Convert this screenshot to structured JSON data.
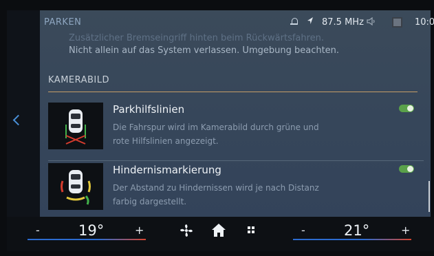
{
  "status_bar": {
    "title": "PARKEN",
    "radio_frequency": "87.5 MHz",
    "time": "10:0"
  },
  "intro": {
    "line1": "Zusätzlicher Bremseingriff hinten beim Rückwärtsfahren.",
    "line2": "Nicht allein auf das System verlassen. Umgebung beachten."
  },
  "section": {
    "label": "KAMERABILD"
  },
  "settings": [
    {
      "title": "Parkhilfslinien",
      "desc_line1": "Die Fahrspur wird im Kamerabild durch grüne und",
      "desc_line2": "rote Hilfslinien angezeigt.",
      "enabled": true
    },
    {
      "title": "Hindernismarkierung",
      "desc_line1": "Der Abstand zu Hindernissen wird je nach Distanz",
      "desc_line2": "farbig dargestellt.",
      "enabled": true
    }
  ],
  "climate": {
    "left_minus": "-",
    "left_temp": "19°",
    "left_plus": "+",
    "right_minus": "-",
    "right_temp": "21°",
    "right_plus": "+"
  },
  "colors": {
    "accent_blue": "#4a90d9",
    "toggle_on": "#5aa14a",
    "section_divider": "#c59d67"
  },
  "icons": {
    "status": [
      "bell-icon",
      "navigation-arrow-icon",
      "speaker-icon",
      "phone-box-icon"
    ],
    "climate": [
      "fan-icon",
      "home-icon",
      "apps-grid-icon"
    ],
    "nav": "back-arrow-icon"
  }
}
